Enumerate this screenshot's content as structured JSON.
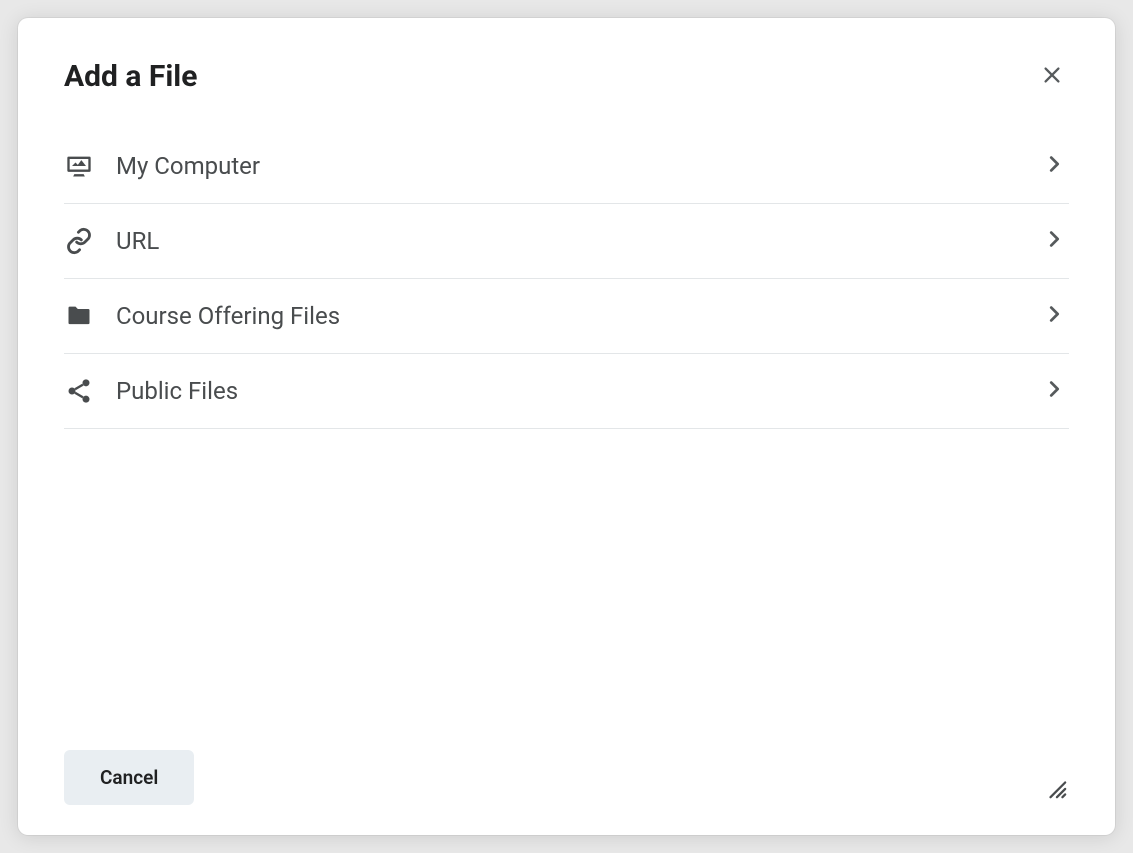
{
  "modal": {
    "title": "Add a File",
    "options": [
      {
        "icon": "image",
        "label": "My Computer"
      },
      {
        "icon": "link",
        "label": "URL"
      },
      {
        "icon": "folder",
        "label": "Course Offering Files"
      },
      {
        "icon": "share",
        "label": "Public Files"
      }
    ],
    "cancel_label": "Cancel"
  }
}
